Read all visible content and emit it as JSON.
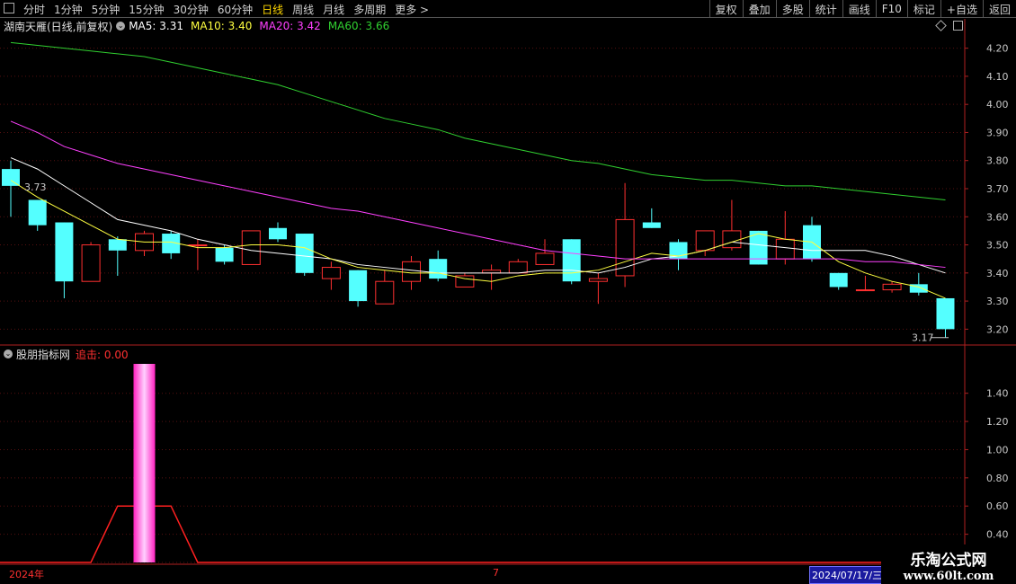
{
  "toolbar": {
    "periods": [
      "分时",
      "1分钟",
      "5分钟",
      "15分钟",
      "30分钟",
      "60分钟",
      "日线",
      "周线",
      "月线",
      "多周期",
      "更多 >"
    ],
    "active_index": 6,
    "actions": [
      "复权",
      "叠加",
      "多股",
      "统计",
      "画线",
      "F10",
      "标记",
      "+自选",
      "返回"
    ]
  },
  "info": {
    "stock": "湖南天雁(日线,前复权)",
    "ma5": "MA5: 3.31",
    "ma10": "MA10: 3.40",
    "ma20": "MA20: 3.42",
    "ma60": "MA60: 3.66"
  },
  "indicator": {
    "name": "股朋指标网",
    "label": "追击: 0.00"
  },
  "dates": {
    "left": "2024年",
    "mid": "7",
    "selected": "2024/07/17/三"
  },
  "watermark": {
    "title": "乐淘公式网",
    "url": "www.60lt.com"
  },
  "colors": {
    "up": "#ff3030",
    "down": "#54ffff",
    "ma5": "#ffffff",
    "ma10": "#ffff40",
    "ma20": "#ff40ff",
    "ma60": "#30d030"
  },
  "chart_data": [
    {
      "type": "candlestick",
      "ylim": [
        3.15,
        4.25
      ],
      "yticks": [
        "4.20",
        "4.10",
        "4.00",
        "3.90",
        "3.80",
        "3.70",
        "3.60",
        "3.50",
        "3.40",
        "3.30",
        "3.20"
      ],
      "high_label": "3.73",
      "low_label": "3.17",
      "candles": [
        {
          "o": 3.77,
          "c": 3.71,
          "h": 3.8,
          "l": 3.6
        },
        {
          "o": 3.66,
          "c": 3.57,
          "h": 3.66,
          "l": 3.55
        },
        {
          "o": 3.58,
          "c": 3.37,
          "h": 3.58,
          "l": 3.31
        },
        {
          "o": 3.37,
          "c": 3.5,
          "h": 3.51,
          "l": 3.37
        },
        {
          "o": 3.52,
          "c": 3.48,
          "h": 3.53,
          "l": 3.39
        },
        {
          "o": 3.48,
          "c": 3.54,
          "h": 3.55,
          "l": 3.46
        },
        {
          "o": 3.54,
          "c": 3.47,
          "h": 3.55,
          "l": 3.45
        },
        {
          "o": 3.5,
          "c": 3.5,
          "h": 3.52,
          "l": 3.41
        },
        {
          "o": 3.49,
          "c": 3.44,
          "h": 3.5,
          "l": 3.43
        },
        {
          "o": 3.43,
          "c": 3.55,
          "h": 3.55,
          "l": 3.43
        },
        {
          "o": 3.56,
          "c": 3.52,
          "h": 3.58,
          "l": 3.51
        },
        {
          "o": 3.54,
          "c": 3.4,
          "h": 3.54,
          "l": 3.39
        },
        {
          "o": 3.38,
          "c": 3.42,
          "h": 3.44,
          "l": 3.34
        },
        {
          "o": 3.41,
          "c": 3.3,
          "h": 3.41,
          "l": 3.28
        },
        {
          "o": 3.29,
          "c": 3.37,
          "h": 3.41,
          "l": 3.29
        },
        {
          "o": 3.37,
          "c": 3.44,
          "h": 3.46,
          "l": 3.34
        },
        {
          "o": 3.45,
          "c": 3.38,
          "h": 3.48,
          "l": 3.37
        },
        {
          "o": 3.35,
          "c": 3.39,
          "h": 3.4,
          "l": 3.35
        },
        {
          "o": 3.4,
          "c": 3.41,
          "h": 3.43,
          "l": 3.34
        },
        {
          "o": 3.4,
          "c": 3.44,
          "h": 3.45,
          "l": 3.4
        },
        {
          "o": 3.43,
          "c": 3.47,
          "h": 3.52,
          "l": 3.43
        },
        {
          "o": 3.52,
          "c": 3.37,
          "h": 3.52,
          "l": 3.36
        },
        {
          "o": 3.37,
          "c": 3.38,
          "h": 3.4,
          "l": 3.29
        },
        {
          "o": 3.39,
          "c": 3.59,
          "h": 3.72,
          "l": 3.35
        },
        {
          "o": 3.58,
          "c": 3.56,
          "h": 3.63,
          "l": 3.56
        },
        {
          "o": 3.51,
          "c": 3.45,
          "h": 3.52,
          "l": 3.41
        },
        {
          "o": 3.48,
          "c": 3.55,
          "h": 3.55,
          "l": 3.46
        },
        {
          "o": 3.49,
          "c": 3.55,
          "h": 3.66,
          "l": 3.48
        },
        {
          "o": 3.55,
          "c": 3.43,
          "h": 3.55,
          "l": 3.43
        },
        {
          "o": 3.45,
          "c": 3.52,
          "h": 3.62,
          "l": 3.43
        },
        {
          "o": 3.57,
          "c": 3.45,
          "h": 3.6,
          "l": 3.44
        },
        {
          "o": 3.4,
          "c": 3.35,
          "h": 3.4,
          "l": 3.34
        },
        {
          "o": 3.34,
          "c": 3.34,
          "h": 3.39,
          "l": 3.34
        },
        {
          "o": 3.34,
          "c": 3.36,
          "h": 3.37,
          "l": 3.33
        },
        {
          "o": 3.36,
          "c": 3.33,
          "h": 3.4,
          "l": 3.32
        },
        {
          "o": 3.31,
          "c": 3.2,
          "h": 3.31,
          "l": 3.17
        }
      ],
      "series": [
        {
          "values": [
            3.81,
            3.77,
            3.71,
            3.65,
            3.59,
            3.57,
            3.55,
            3.52,
            3.5,
            3.48,
            3.47,
            3.46,
            3.45,
            3.43,
            3.42,
            3.41,
            3.4,
            3.4,
            3.4,
            3.4,
            3.41,
            3.41,
            3.4,
            3.42,
            3.45,
            3.46,
            3.48,
            3.51,
            3.5,
            3.49,
            3.48,
            3.48,
            3.48,
            3.46,
            3.43,
            3.4
          ]
        },
        {
          "values": [
            3.73,
            3.67,
            3.62,
            3.57,
            3.52,
            3.51,
            3.51,
            3.49,
            3.49,
            3.5,
            3.5,
            3.49,
            3.45,
            3.42,
            3.41,
            3.4,
            3.4,
            3.38,
            3.37,
            3.39,
            3.4,
            3.4,
            3.41,
            3.44,
            3.47,
            3.46,
            3.48,
            3.51,
            3.54,
            3.52,
            3.51,
            3.44,
            3.4,
            3.37,
            3.35,
            3.31
          ]
        },
        {
          "values": [
            3.94,
            3.9,
            3.85,
            3.82,
            3.79,
            3.77,
            3.75,
            3.73,
            3.71,
            3.69,
            3.67,
            3.65,
            3.63,
            3.62,
            3.6,
            3.58,
            3.56,
            3.54,
            3.52,
            3.5,
            3.48,
            3.47,
            3.46,
            3.45,
            3.45,
            3.45,
            3.45,
            3.45,
            3.45,
            3.45,
            3.45,
            3.45,
            3.44,
            3.44,
            3.43,
            3.42
          ]
        },
        {
          "values": [
            4.22,
            4.21,
            4.2,
            4.19,
            4.18,
            4.17,
            4.15,
            4.13,
            4.11,
            4.09,
            4.07,
            4.04,
            4.01,
            3.98,
            3.95,
            3.93,
            3.91,
            3.88,
            3.86,
            3.84,
            3.82,
            3.8,
            3.79,
            3.77,
            3.75,
            3.74,
            3.73,
            3.73,
            3.72,
            3.71,
            3.71,
            3.7,
            3.69,
            3.68,
            3.67,
            3.66
          ]
        }
      ]
    },
    {
      "type": "bar",
      "ylim": [
        0.2,
        1.5
      ],
      "yticks": [
        "1.40",
        "1.20",
        "1.00",
        "0.80",
        "0.60",
        "0.40",
        "0.20"
      ],
      "values": [
        0,
        0,
        0,
        0,
        0,
        1.5,
        0,
        0,
        0,
        0,
        0,
        0,
        0,
        0,
        0,
        0,
        0,
        0,
        0,
        0,
        0,
        0,
        0,
        0,
        0,
        0,
        0,
        0,
        0,
        0,
        0,
        0,
        0,
        0,
        0,
        0
      ],
      "series": [
        {
          "values": [
            0,
            0,
            0,
            0,
            0.6,
            0.6,
            0.6,
            0,
            0,
            0,
            0,
            0,
            0,
            0,
            0,
            0,
            0,
            0,
            0,
            0,
            0,
            0,
            0,
            0,
            0,
            0,
            0,
            0,
            0,
            0,
            0,
            0,
            0,
            0,
            0,
            0
          ]
        }
      ]
    }
  ]
}
